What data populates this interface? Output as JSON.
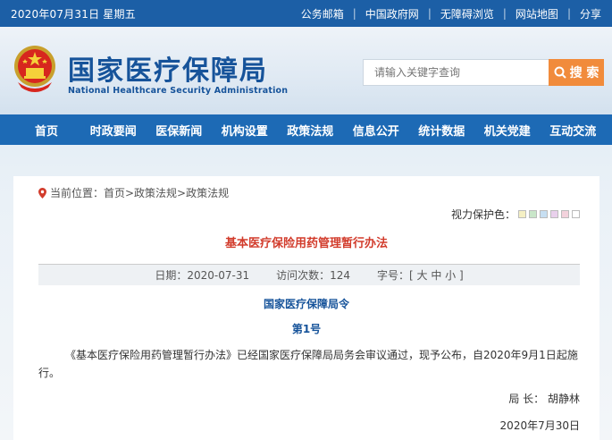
{
  "topbar": {
    "date": "2020年07月31日 星期五",
    "links": [
      "公务邮箱",
      "中国政府网",
      "无障碍浏览",
      "网站地图",
      "分享"
    ]
  },
  "header": {
    "title_zh": "国家医疗保障局",
    "title_en": "National Healthcare Security Administration",
    "search_placeholder": "请输入关键字查询",
    "search_button": "搜 索"
  },
  "nav": [
    "首页",
    "时政要闻",
    "医保新闻",
    "机构设置",
    "政策法规",
    "信息公开",
    "统计数据",
    "机关党建",
    "互动交流"
  ],
  "breadcrumb": "当前位置：首页>政策法规>政策法规",
  "vision": {
    "label": "视力保护色：",
    "colors": [
      "#f5f0c4",
      "#c9e6c9",
      "#c7dff2",
      "#e9d0ec",
      "#f3d2dc",
      "#ffffff"
    ]
  },
  "article": {
    "title": "基本医疗保险用药管理暂行办法",
    "date_label": "日期：2020-07-31",
    "visits_label": "访问次数：124",
    "font_label": "字号：[ 大 中 小 ]",
    "issuer": "国家医疗保障局令",
    "number": "第1号",
    "body": "《基本医疗保险用药管理暂行办法》已经国家医疗保障局局务会审议通过，现予公布，自2020年9月1日起施行。",
    "signer": "局 长：  胡静林",
    "sign_date": "2020年7月30日"
  },
  "colors": {
    "topbar": "#1c5fa6",
    "nav": "#1d6ab5",
    "brand": "#16539a",
    "title_red": "#d23c2c",
    "search_btn": "#f18b3b"
  }
}
